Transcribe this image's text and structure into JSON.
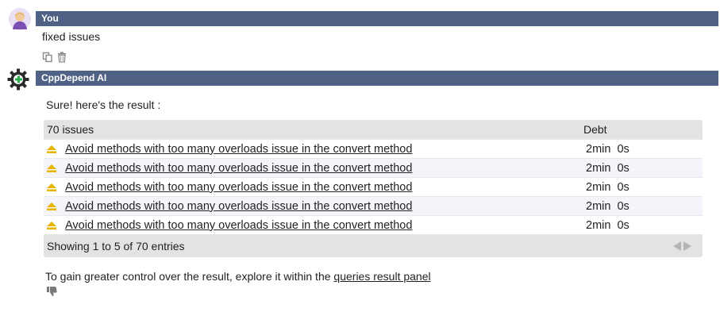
{
  "user": {
    "name": "You",
    "message": "fixed issues",
    "avatar_icon": "user-avatar-icon",
    "actions": [
      {
        "icon": "copy-icon"
      },
      {
        "icon": "trash-icon"
      }
    ]
  },
  "assistant": {
    "name": "CppDepend AI",
    "avatar_icon": "gear-plus-icon",
    "intro": "Sure! here's the result :",
    "table": {
      "header_issue": "70 issues",
      "header_debt": "Debt",
      "rows": [
        {
          "issue": "Avoid methods with too many overloads issue in the convert method",
          "debt": "2min  0s"
        },
        {
          "issue": "Avoid methods with too many overloads issue in the convert method",
          "debt": "2min  0s"
        },
        {
          "issue": "Avoid methods with too many overloads issue in the convert method",
          "debt": "2min  0s"
        },
        {
          "issue": "Avoid methods with too many overloads issue in the convert method",
          "debt": "2min  0s"
        },
        {
          "issue": "Avoid methods with too many overloads issue in the convert method",
          "debt": "2min  0s"
        }
      ],
      "footer_info": "Showing 1 to 5 of 70 entries"
    },
    "outro_text": "To gain greater control over the result, explore it within the ",
    "outro_link": "queries result panel"
  },
  "colors": {
    "header_bar": "#4f6285",
    "warning_icon": "#e8b400",
    "accent_green": "#2eae4a"
  }
}
